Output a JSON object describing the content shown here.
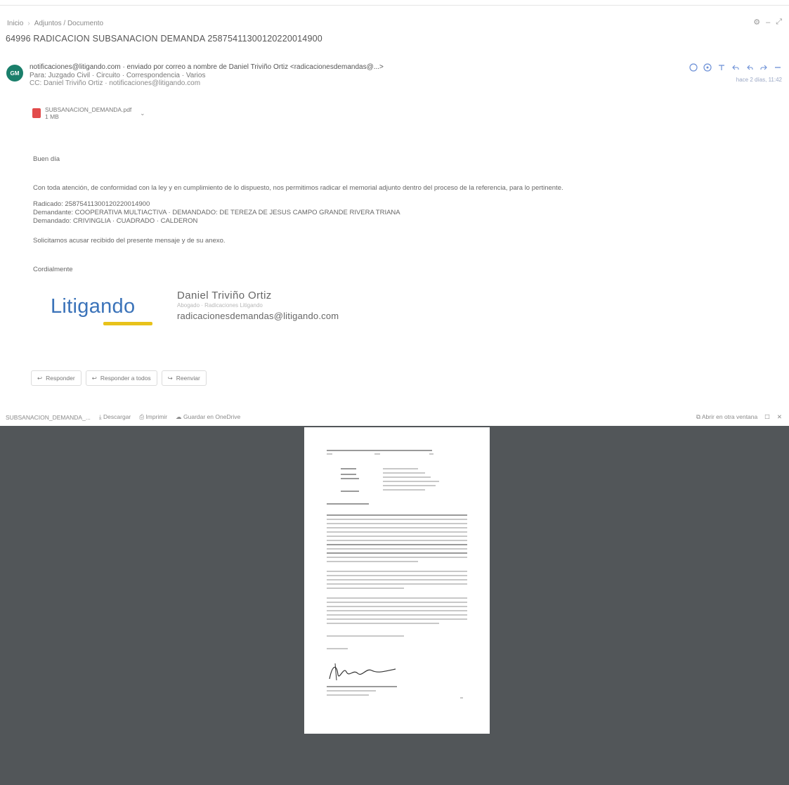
{
  "breadcrumb": {
    "first": "Inicio",
    "second": "Adjuntos / Documento"
  },
  "subject": "64996 RADICACION SUBSANACION DEMANDA 25875411300120220014900",
  "sender": {
    "initials": "GM",
    "from_line": "notificaciones@litigando.com · enviado por correo a nombre de Daniel Triviño Ortiz <radicacionesdemandas@...>",
    "to_line": "Para: Juzgado Civil · Circuito · Correspondencia · Varios",
    "cc_line": "CC: Daniel Triviño Ortiz · notificaciones@litigando.com"
  },
  "date_label": "hace 2 días, 11:42",
  "attachment": {
    "name": "SUBSANACION_DEMANDA.pdf",
    "size": "1 MB"
  },
  "body": {
    "greeting": "Buen día",
    "intro": "Con toda atención, de conformidad con la ley y en cumplimiento de lo dispuesto, nos permitimos radicar el memorial adjunto dentro del proceso de la referencia, para lo pertinente.",
    "radicado": "Radicado: 25875411300120220014900",
    "demandante": "Demandante: COOPERATIVA MULTIACTIVA · DEMANDADO: DE TEREZA DE JESUS CAMPO GRANDE RIVERA TRIANA",
    "demandado": "Demandado: CRIVINGLIA · CUADRADO · CALDERON",
    "request": "Solicitamos acusar recibido del presente mensaje y de su anexo.",
    "closing": "Cordialmente"
  },
  "signature": {
    "logo": "Litigando",
    "name": "Daniel Triviño Ortiz",
    "role": "Abogado · Radicaciones Litigando",
    "email": "radicacionesdemandas@litigando.com"
  },
  "reply_buttons": [
    "Responder",
    "Responder a todos",
    "Reenviar"
  ],
  "pdf_toolbar": {
    "filename": "SUBSANACION_DEMANDA_...",
    "download": "Descargar",
    "print": "Imprimir",
    "save": "Guardar en OneDrive",
    "open_label": "Abrir en otra ventana"
  },
  "colors": {
    "avatar": "#1a7f6b",
    "viewer_bg": "#525659",
    "logo_blue": "#3b73b9",
    "logo_yellow": "#e8c21a",
    "action_blue": "#6b8fd6"
  }
}
